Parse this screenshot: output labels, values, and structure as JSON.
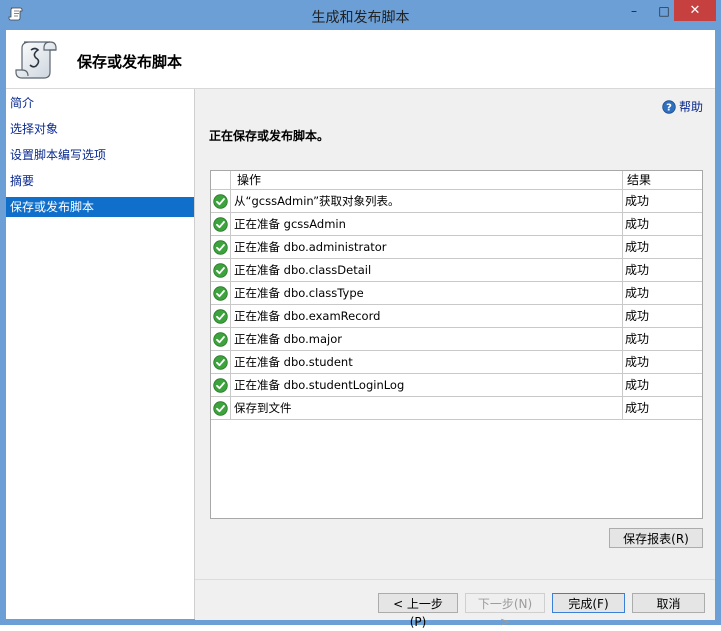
{
  "window": {
    "title": "生成和发布脚本",
    "minimize_glyph": "–",
    "maximize_glyph": "□",
    "close_glyph": "✕"
  },
  "header": {
    "title": "保存或发布脚本",
    "icon": "script-scroll-icon"
  },
  "sidebar": {
    "items": [
      {
        "label": "简介",
        "selected": false
      },
      {
        "label": "选择对象",
        "selected": false
      },
      {
        "label": "设置脚本编写选项",
        "selected": false
      },
      {
        "label": "摘要",
        "selected": false
      },
      {
        "label": "保存或发布脚本",
        "selected": true
      }
    ]
  },
  "main": {
    "help_label": "帮助",
    "status_text": "正在保存或发布脚本。",
    "table": {
      "columns": [
        "操作",
        "结果"
      ],
      "rows": [
        {
          "operation": "从“gcssAdmin”获取对象列表。",
          "result": "成功"
        },
        {
          "operation": "正在准备 gcssAdmin",
          "result": "成功"
        },
        {
          "operation": "正在准备 dbo.administrator",
          "result": "成功"
        },
        {
          "operation": "正在准备 dbo.classDetail",
          "result": "成功"
        },
        {
          "operation": "正在准备 dbo.classType",
          "result": "成功"
        },
        {
          "operation": "正在准备 dbo.examRecord",
          "result": "成功"
        },
        {
          "operation": "正在准备 dbo.major",
          "result": "成功"
        },
        {
          "operation": "正在准备 dbo.student",
          "result": "成功"
        },
        {
          "operation": "正在准备 dbo.studentLoginLog",
          "result": "成功"
        },
        {
          "operation": "保存到文件",
          "result": "成功"
        }
      ]
    },
    "save_report_label": "保存报表(R)"
  },
  "footer": {
    "back_label": "< 上一步(P)",
    "next_label": "下一步(N) >",
    "finish_label": "完成(F)",
    "cancel_label": "取消"
  },
  "colors": {
    "titlebar": "#6b9fd6",
    "close_button": "#c74040",
    "selected_nav": "#0f6fcb",
    "link_text": "#0a2a8f",
    "success_icon": "#3da33d"
  }
}
